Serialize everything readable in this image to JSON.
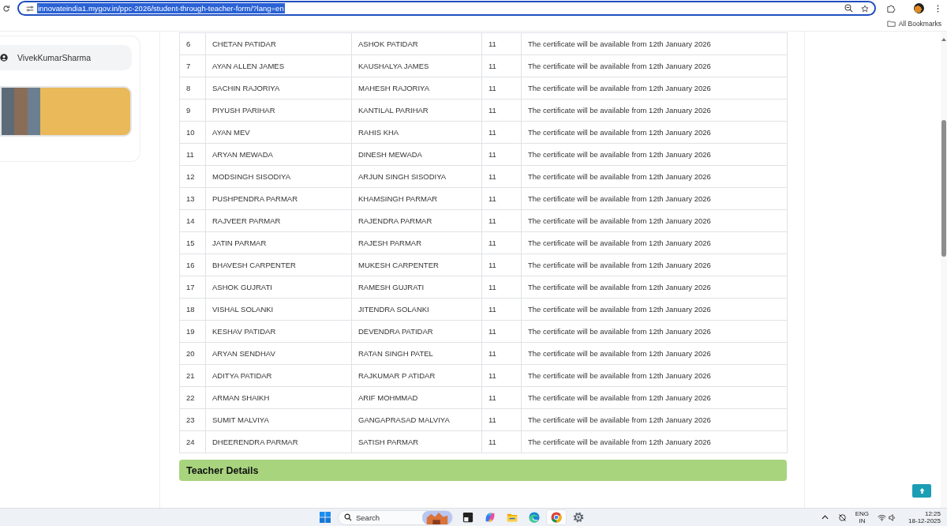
{
  "browser": {
    "url": "innovateindia1.mygov.in/ppc-2026/student-through-teacher-form/?lang=en",
    "address_focused": true,
    "url_selected": true,
    "bookmarks": [
      {
        "label": "All Bookmarks"
      }
    ]
  },
  "sidebar": {
    "user_name": "VivekKumarSharma"
  },
  "table": {
    "rows": [
      {
        "cells": [
          "6",
          "CHETAN PATIDAR",
          "ASHOK PATIDAR",
          "11",
          "The certificate will be available from 12th January 2026"
        ]
      },
      {
        "cells": [
          "7",
          "AYAN ALLEN JAMES",
          "KAUSHALYA JAMES",
          "11",
          "The certificate will be available from 12th January 2026"
        ]
      },
      {
        "cells": [
          "8",
          "SACHIN RAJORIYA",
          "MAHESH RAJORIYA",
          "11",
          "The certificate will be available from 12th January 2026"
        ]
      },
      {
        "cells": [
          "9",
          "PIYUSH PARIHAR",
          "KANTILAL PARIHAR",
          "11",
          "The certificate will be available from 12th January 2026"
        ]
      },
      {
        "cells": [
          "10",
          "AYAN MEV",
          "RAHIS KHA",
          "11",
          "The certificate will be available from 12th January 2026"
        ]
      },
      {
        "cells": [
          "11",
          "ARYAN MEWADA",
          "DINESH MEWADA",
          "11",
          "The certificate will be available from 12th January 2026"
        ]
      },
      {
        "cells": [
          "12",
          "MODSINGH SISODIYA",
          "ARJUN SINGH SISODIYA",
          "11",
          "The certificate will be available from 12th January 2026"
        ]
      },
      {
        "cells": [
          "13",
          "PUSHPENDRA PARMAR",
          "KHAMSINGH PARMAR",
          "11",
          "The certificate will be available from 12th January 2026"
        ]
      },
      {
        "cells": [
          "14",
          "RAJVEER PARMAR",
          "RAJENDRA PARMAR",
          "11",
          "The certificate will be available from 12th January 2026"
        ]
      },
      {
        "cells": [
          "15",
          "JATIN PARMAR",
          "RAJESH PARMAR",
          "11",
          "The certificate will be available from 12th January 2026"
        ]
      },
      {
        "cells": [
          "16",
          "BHAVESH CARPENTER",
          "MUKESH CARPENTER",
          "11",
          "The certificate will be available from 12th January 2026"
        ]
      },
      {
        "cells": [
          "17",
          "ASHOK GUJRATI",
          "RAMESH GUJRATI",
          "11",
          "The certificate will be available from 12th January 2026"
        ]
      },
      {
        "cells": [
          "18",
          "VISHAL SOLANKI",
          "JITENDRA SOLANKI",
          "11",
          "The certificate will be available from 12th January 2026"
        ]
      },
      {
        "cells": [
          "19",
          "KESHAV PATIDAR",
          "DEVENDRA PATIDAR",
          "11",
          "The certificate will be available from 12th January 2026"
        ]
      },
      {
        "cells": [
          "20",
          "ARYAN SENDHAV",
          "RATAN SINGH PATEL",
          "11",
          "The certificate will be available from 12th January 2026"
        ]
      },
      {
        "cells": [
          "21",
          "ADITYA PATIDAR",
          "RAJKUMAR P ATIDAR",
          "11",
          "The certificate will be available from 12th January 2026"
        ]
      },
      {
        "cells": [
          "22",
          "ARMAN SHAIKH",
          "ARIF MOHMMAD",
          "11",
          "The certificate will be available from 12th January 2026"
        ]
      },
      {
        "cells": [
          "23",
          "SUMIT MALVIYA",
          "GANGAPRASAD MALVIYA",
          "11",
          "The certificate will be available from 12th January 2026"
        ]
      },
      {
        "cells": [
          "24",
          "DHEERENDRA PARMAR",
          "SATISH PARMAR",
          "11",
          "The certificate will be available from 12th January 2026"
        ]
      }
    ]
  },
  "section": {
    "title": "Teacher Details"
  },
  "taskbar": {
    "search": {
      "placeholder": "Search"
    },
    "apps": [
      {
        "kind": "window",
        "selected": false
      },
      {
        "kind": "swirl",
        "selected": false
      },
      {
        "kind": "folder",
        "selected": false
      },
      {
        "kind": "wave",
        "selected": false
      },
      {
        "kind": "ring",
        "selected": true
      },
      {
        "kind": "gear",
        "selected": false
      }
    ],
    "language": "ENG",
    "region": "IN",
    "time": "12:25",
    "date": "18-12-2025"
  }
}
